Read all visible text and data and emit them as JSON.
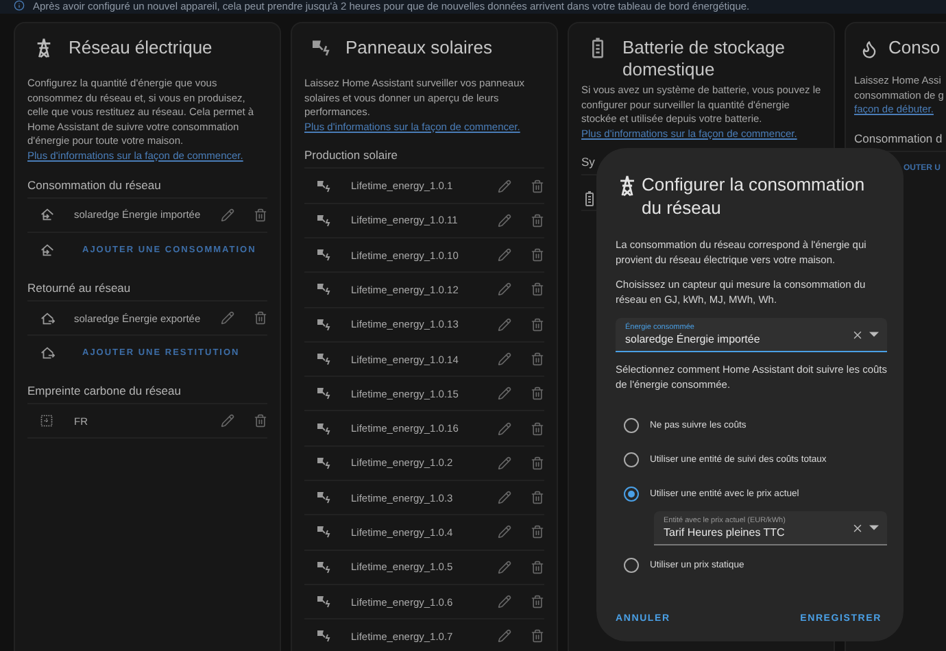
{
  "notice": {
    "text": "Après avoir configuré un nouvel appareil, cela peut prendre jusqu'à 2 heures pour que de nouvelles données arrivent dans votre tableau de bord énergétique."
  },
  "cards": [
    {
      "kind": "grid",
      "title": "Réseau électrique",
      "description": "Configurez la quantité d'énergie que vous consommez du réseau et, si vous en produisez, celle que vous restituez au réseau. Cela permet à Home Assistant de suivre votre consommation d'énergie pour toute votre maison.",
      "link": "Plus d'informations sur la façon de commencer.",
      "sections": [
        {
          "title": "Consommation du réseau",
          "items": [
            {
              "kind": "import",
              "label": "solaredge Énergie importée"
            }
          ],
          "add_button": {
            "kind": "import",
            "label": "AJOUTER UNE CONSOMMATION"
          }
        },
        {
          "title": "Retourné au réseau",
          "items": [
            {
              "kind": "export",
              "label": "solaredge Énergie exportée"
            }
          ],
          "add_button": {
            "kind": "export",
            "label": "AJOUTER UNE RESTITUTION"
          }
        },
        {
          "title": "Empreinte carbone du réseau",
          "items": [
            {
              "kind": "carbon",
              "label": "FR"
            }
          ]
        }
      ]
    },
    {
      "kind": "solar",
      "title": "Panneaux solaires",
      "description": "Laissez Home Assistant surveiller vos panneaux solaires et vous donner un aperçu de leurs performances.",
      "link": "Plus d'informations sur la façon de commencer.",
      "sections": [
        {
          "title": "Production solaire",
          "items": [
            {
              "kind": "solar",
              "label": "Lifetime_energy_1.0.1"
            },
            {
              "kind": "solar",
              "label": "Lifetime_energy_1.0.11"
            },
            {
              "kind": "solar",
              "label": "Lifetime_energy_1.0.10"
            },
            {
              "kind": "solar",
              "label": "Lifetime_energy_1.0.12"
            },
            {
              "kind": "solar",
              "label": "Lifetime_energy_1.0.13"
            },
            {
              "kind": "solar",
              "label": "Lifetime_energy_1.0.14"
            },
            {
              "kind": "solar",
              "label": "Lifetime_energy_1.0.15"
            },
            {
              "kind": "solar",
              "label": "Lifetime_energy_1.0.16"
            },
            {
              "kind": "solar",
              "label": "Lifetime_energy_1.0.2"
            },
            {
              "kind": "solar",
              "label": "Lifetime_energy_1.0.3"
            },
            {
              "kind": "solar",
              "label": "Lifetime_energy_1.0.4"
            },
            {
              "kind": "solar",
              "label": "Lifetime_energy_1.0.5"
            },
            {
              "kind": "solar",
              "label": "Lifetime_energy_1.0.6"
            },
            {
              "kind": "solar",
              "label": "Lifetime_energy_1.0.7"
            }
          ]
        }
      ]
    },
    {
      "kind": "battery",
      "title": "Batterie de stockage domestique",
      "description": "Si vous avez un système de batterie, vous pouvez le configurer pour surveiller la quantité d'énergie stockée et utilisée depuis votre batterie.",
      "link": "Plus d'informations sur la façon de commencer.",
      "sections": [
        {
          "title": "Sy",
          "items": [
            {
              "kind": "battery"
            }
          ]
        }
      ]
    },
    {
      "kind": "gas",
      "title": "Conso",
      "lines": [
        "Laissez Home Assi",
        "consommation de g"
      ],
      "link": "façon de débuter.",
      "sections": [
        {
          "title": "Consommation d",
          "add_button": {
            "kind": "cut",
            "label": "OUTER U"
          }
        }
      ]
    }
  ],
  "dialog": {
    "title": "Configurer la consommation du réseau",
    "paragraphs": [
      "La consommation du réseau correspond à l'énergie qui provient du réseau électrique vers votre maison.",
      "Choisissez un capteur qui mesure la consommation du réseau en GJ, kWh, MJ, MWh, Wh."
    ],
    "sensor_field": {
      "label": "Énergie consommée",
      "value": "solaredge Énergie importée"
    },
    "cost_prompt": "Sélectionnez comment Home Assistant doit suivre les coûts de l'énergie consommée.",
    "cost_options": [
      {
        "label": "Ne pas suivre les coûts",
        "selected": false
      },
      {
        "label": "Utiliser une entité de suivi des coûts totaux",
        "selected": false
      },
      {
        "label": "Utiliser une entité avec le prix actuel",
        "selected": true,
        "field": {
          "label": "Entité avec le prix actuel (EUR/kWh)",
          "value": "Tarif Heures pleines TTC"
        }
      },
      {
        "label": "Utiliser un prix statique",
        "selected": false
      }
    ],
    "buttons": [
      {
        "label": "ANNULER"
      },
      {
        "label": "ENREGISTRER"
      }
    ]
  }
}
